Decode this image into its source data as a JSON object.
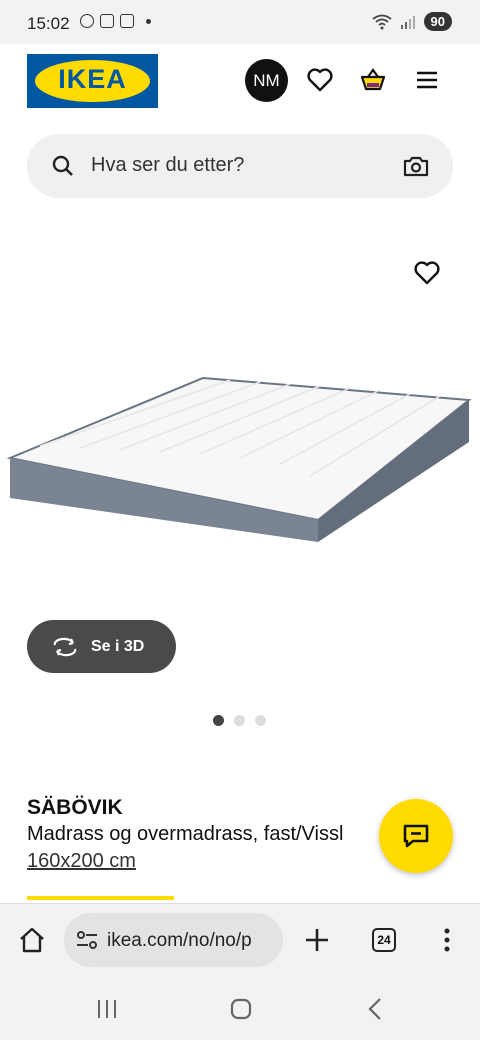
{
  "status_bar": {
    "time": "15:02",
    "battery": "90"
  },
  "header": {
    "logo_text": "IKEA",
    "avatar_initials": "NM",
    "brand_blue": "#0058a3",
    "brand_yellow": "#ffdb00"
  },
  "search": {
    "placeholder": "Hva ser du etter?"
  },
  "gallery": {
    "view_3d_label": "Se i 3D",
    "image_count": 3,
    "active_index": 0
  },
  "product": {
    "name": "SÄBÖVIK",
    "description": "Madrass og overmadrass, fast/Vissl",
    "size": "160x200 cm"
  },
  "browser": {
    "url": "ikea.com/no/no/p",
    "tab_count": "24"
  },
  "icons": [
    "wifi-icon",
    "signal-icon",
    "heart-icon",
    "basket-icon",
    "menu-icon",
    "search-icon",
    "camera-icon",
    "rotate-3d-icon",
    "chat-icon",
    "home-icon",
    "site-settings-icon",
    "plus-icon",
    "more-icon"
  ]
}
